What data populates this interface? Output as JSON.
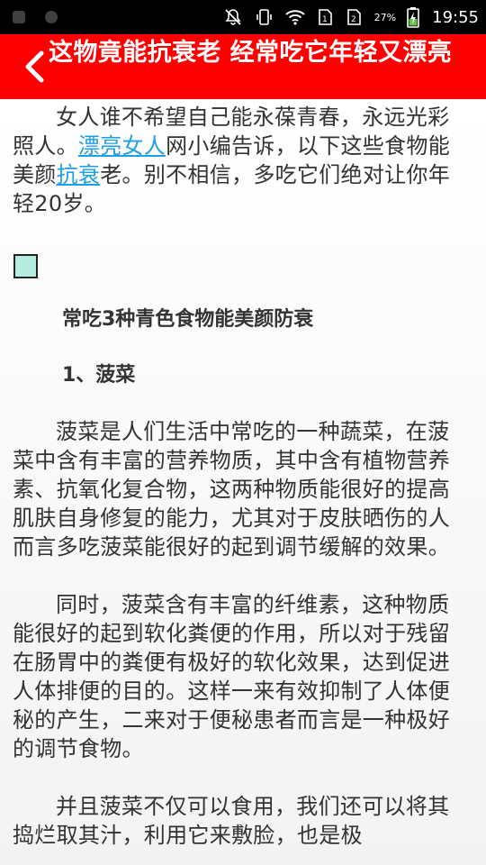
{
  "status": {
    "battery_percent": "27%",
    "time": "19:55"
  },
  "header": {
    "title": "这物竟能抗衰老 经常吃它年轻又漂亮"
  },
  "article": {
    "intro_prefix": "女人谁不希望自己能永葆青春，永远光彩照人。",
    "link1": "漂亮女人",
    "intro_mid": "网小编告诉，以下这些食物能美颜",
    "link2": "抗衰",
    "intro_suffix": "老。别不相信，多吃它们绝对让你年轻20岁。",
    "heading": "常吃3种青色食物能美颜防衰",
    "subheading": "1、菠菜",
    "p1": "菠菜是人们生活中常吃的一种蔬菜，在菠菜中含有丰富的营养物质，其中含有植物营养素、抗氧化复合物，这两种物质能很好的提高肌肤自身修复的能力，尤其对于皮肤晒伤的人而言多吃菠菜能很好的起到调节缓解的效果。",
    "p2": "同时，菠菜含有丰富的纤维素，这种物质能很好的起到软化粪便的作用，所以对于残留在肠胃中的粪便有极好的软化效果，达到促进人体排便的目的。这样一来有效抑制了人体便秘的产生，二来对于便秘患者而言是一种极好的调节食物。",
    "p3": "并且菠菜不仅可以食用，我们还可以将其捣烂取其汁，利用它来敷脸，也是极"
  }
}
